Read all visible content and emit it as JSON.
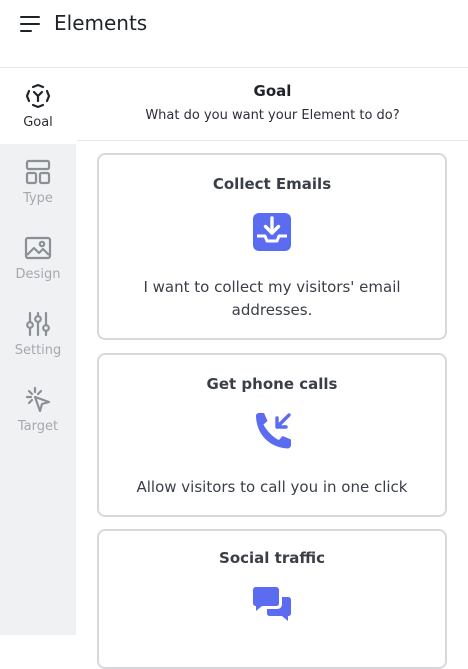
{
  "header": {
    "title": "Elements"
  },
  "sidebar": {
    "items": [
      {
        "label": "Goal",
        "icon": "target-icon",
        "active": true
      },
      {
        "label": "Type",
        "icon": "layout-icon",
        "active": false
      },
      {
        "label": "Design",
        "icon": "image-icon",
        "active": false
      },
      {
        "label": "Setting",
        "icon": "sliders-icon",
        "active": false
      },
      {
        "label": "Target",
        "icon": "cursor-click-icon",
        "active": false
      }
    ]
  },
  "panel": {
    "title": "Goal",
    "subtitle": "What do you want your Element to do?"
  },
  "cards": [
    {
      "title": "Collect Emails",
      "icon": "inbox-download-icon",
      "description": "I want to collect my visitors' email addresses."
    },
    {
      "title": "Get phone calls",
      "icon": "phone-incoming-icon",
      "description": "Allow visitors to call you in one click"
    },
    {
      "title": "Social traffic",
      "icon": "chat-bubbles-icon",
      "description": ""
    }
  ],
  "colors": {
    "accent": "#5b6cf0",
    "sidebar_bg": "#f0f1f3",
    "muted": "#a4a9b0"
  }
}
